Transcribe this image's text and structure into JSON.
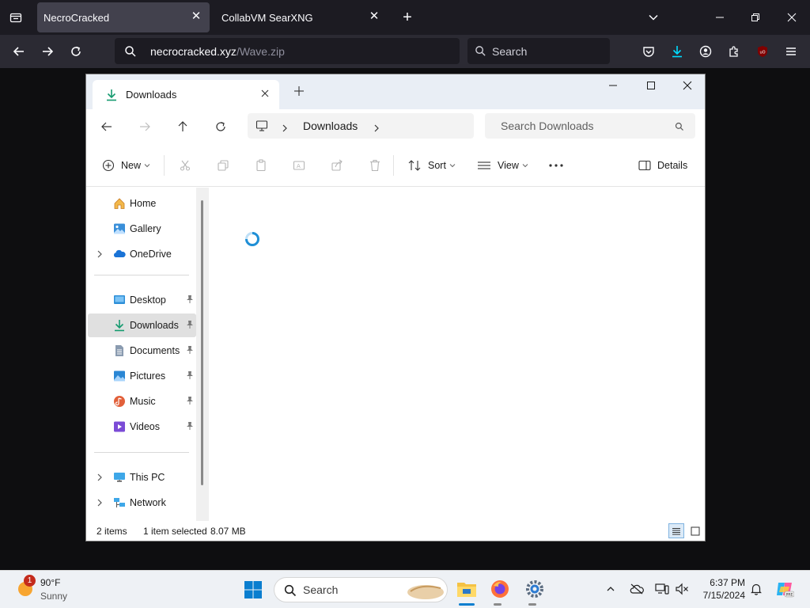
{
  "browser": {
    "tabs": [
      {
        "label": "NecroCracked",
        "active": true
      },
      {
        "label": "CollabVM SearXNG",
        "active": false
      }
    ],
    "url": {
      "host": "necrocracked.xyz",
      "path": "/Wave.zip"
    },
    "search_placeholder": "Search"
  },
  "explorer": {
    "tab_title": "Downloads",
    "breadcrumb": "Downloads",
    "search_placeholder": "Search Downloads",
    "commands": {
      "new": "New",
      "sort": "Sort",
      "view": "View",
      "details": "Details"
    },
    "nav": {
      "group1": [
        "Home",
        "Gallery",
        "OneDrive"
      ],
      "pinned": [
        "Desktop",
        "Downloads",
        "Documents",
        "Pictures",
        "Music",
        "Videos"
      ],
      "group3": [
        "This PC",
        "Network"
      ]
    },
    "status": {
      "items": "2 items",
      "selected": "1 item selected",
      "size": "8.07 MB"
    }
  },
  "taskbar": {
    "weather": {
      "temp": "90°F",
      "condition": "Sunny",
      "badge": "1"
    },
    "search_placeholder": "Search",
    "clock": {
      "time": "6:37 PM",
      "date": "7/15/2024"
    }
  },
  "colors": {
    "browser_bg": "#1c1b22",
    "accent": "#0a7ecf",
    "download_green": "#159a6f"
  }
}
